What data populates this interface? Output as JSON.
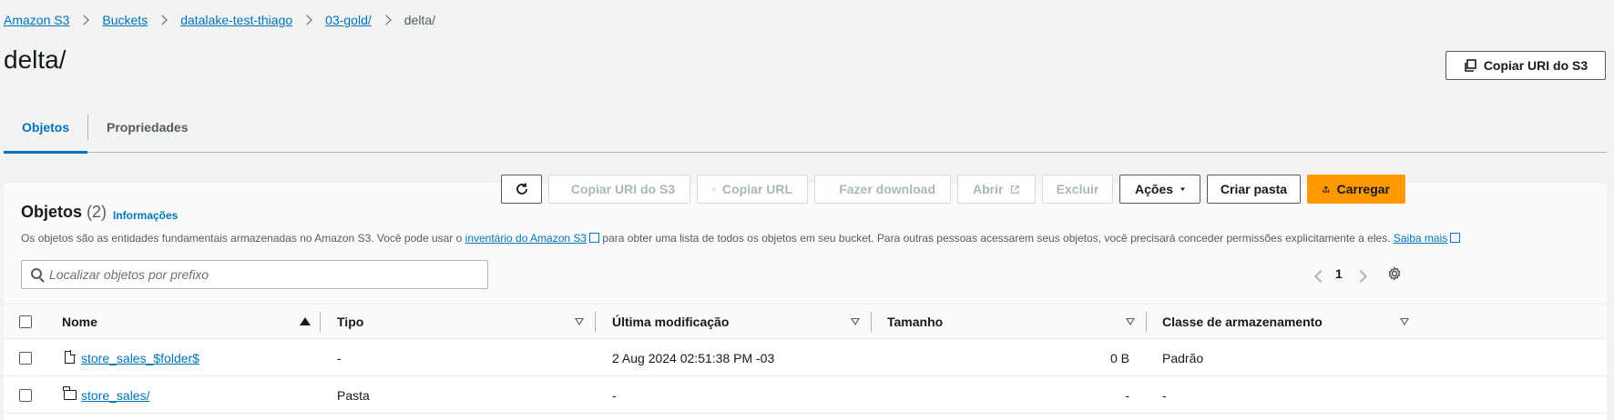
{
  "breadcrumb": {
    "items": [
      "Amazon S3",
      "Buckets",
      "datalake-test-thiago",
      "03-gold/"
    ],
    "current": "delta/"
  },
  "page": {
    "title": "delta/",
    "copy_uri_label": "Copiar URI do S3"
  },
  "tabs": [
    {
      "label": "Objetos",
      "active": true
    },
    {
      "label": "Propriedades",
      "active": false
    }
  ],
  "objects_panel": {
    "title": "Objetos",
    "count": "(2)",
    "info_label": "Informações",
    "description_before": "Os objetos são as entidades fundamentais armazenadas no Amazon S3. Você pode usar o ",
    "inventory_link": "inventário do Amazon S3",
    "description_after": " para obter uma lista de todos os objetos em seu bucket. Para outras pessoas acessarem seus objetos, você precisará conceder permissões explicitamente a eles. ",
    "learn_more": "Saiba mais",
    "toolbar": {
      "copy_uri": "Copiar URI do S3",
      "copy_url": "Copiar URL",
      "download": "Fazer download",
      "open": "Abrir",
      "delete": "Excluir",
      "actions": "Ações",
      "create_folder": "Criar pasta",
      "upload": "Carregar"
    },
    "search_placeholder": "Localizar objetos por prefixo",
    "page_number": "1"
  },
  "table": {
    "columns": [
      "Nome",
      "Tipo",
      "Última modificação",
      "Tamanho",
      "Classe de armazenamento"
    ],
    "rows": [
      {
        "name": "store_sales_$folder$",
        "type": "-",
        "modified": "2 Aug 2024 02:51:38 PM -03",
        "size": "0 B",
        "class": "Padrão",
        "icon": "file-icon"
      },
      {
        "name": "store_sales/",
        "type": "Pasta",
        "modified": "-",
        "size": "-",
        "class": "-",
        "icon": "folder-icon"
      }
    ]
  },
  "colors": {
    "link": "#0073bb",
    "primary": "#ff9900",
    "background": "#f2f3f3"
  }
}
